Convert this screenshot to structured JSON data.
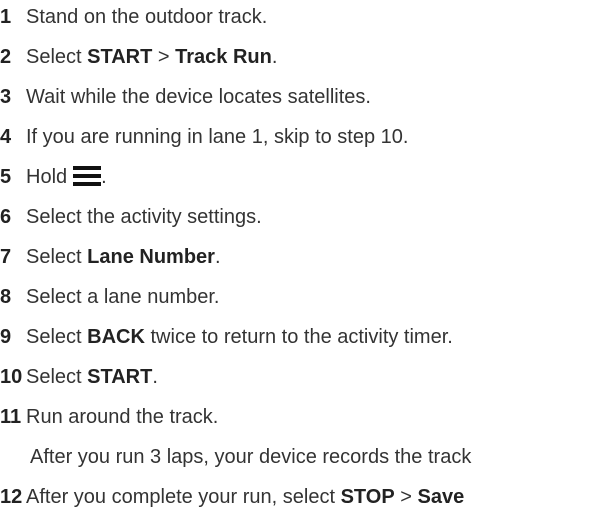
{
  "steps": [
    {
      "num": "1",
      "parts": [
        {
          "t": "Stand on the outdoor track.",
          "b": false
        }
      ]
    },
    {
      "num": "2",
      "parts": [
        {
          "t": "Select ",
          "b": false
        },
        {
          "t": "START",
          "b": true
        },
        {
          "t": " > ",
          "b": false
        },
        {
          "t": "Track Run",
          "b": true
        },
        {
          "t": ".",
          "b": false
        }
      ]
    },
    {
      "num": "3",
      "parts": [
        {
          "t": "Wait while the device locates satellites.",
          "b": false
        }
      ]
    },
    {
      "num": "4",
      "parts": [
        {
          "t": "If you are running in lane 1, skip to step 10.",
          "b": false
        }
      ]
    },
    {
      "num": "5",
      "parts": [
        {
          "t": "Hold",
          "b": false
        }
      ],
      "icon": "menu-icon",
      "after": "."
    },
    {
      "num": "6",
      "parts": [
        {
          "t": "Select the activity settings.",
          "b": false
        }
      ]
    },
    {
      "num": "7",
      "parts": [
        {
          "t": "Select ",
          "b": false
        },
        {
          "t": "Lane Number",
          "b": true
        },
        {
          "t": ".",
          "b": false
        }
      ]
    },
    {
      "num": "8",
      "parts": [
        {
          "t": "Select a lane number.",
          "b": false
        }
      ]
    },
    {
      "num": "9",
      "parts": [
        {
          "t": "Select ",
          "b": false
        },
        {
          "t": "BACK",
          "b": true
        },
        {
          "t": " twice to return to the activity timer.",
          "b": false
        }
      ]
    },
    {
      "num": "10",
      "parts": [
        {
          "t": "Select ",
          "b": false
        },
        {
          "t": "START",
          "b": true
        },
        {
          "t": ".",
          "b": false
        }
      ]
    },
    {
      "num": "11",
      "parts": [
        {
          "t": "Run around the track.",
          "b": false
        }
      ]
    },
    {
      "num": "",
      "parts": [
        {
          "t": "After you run 3 laps, your device records the track",
          "b": false
        }
      ]
    },
    {
      "num": "12",
      "parts": [
        {
          "t": "After you complete your run, select ",
          "b": false
        },
        {
          "t": "STOP",
          "b": true
        },
        {
          "t": " > ",
          "b": false
        },
        {
          "t": "Save",
          "b": true
        }
      ]
    }
  ]
}
